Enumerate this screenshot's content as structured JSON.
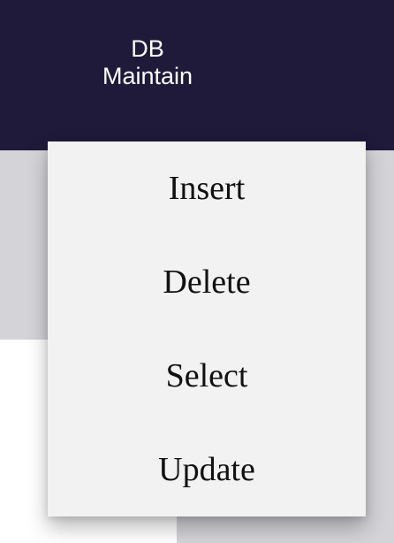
{
  "navbar": {
    "item": {
      "line1": "DB",
      "line2": "Maintain"
    },
    "background_color": "#1f1a3a"
  },
  "dropdown": {
    "items": [
      {
        "label": "Insert"
      },
      {
        "label": "Delete"
      },
      {
        "label": "Select"
      },
      {
        "label": "Update"
      }
    ],
    "background_color": "#f2f2f2"
  }
}
